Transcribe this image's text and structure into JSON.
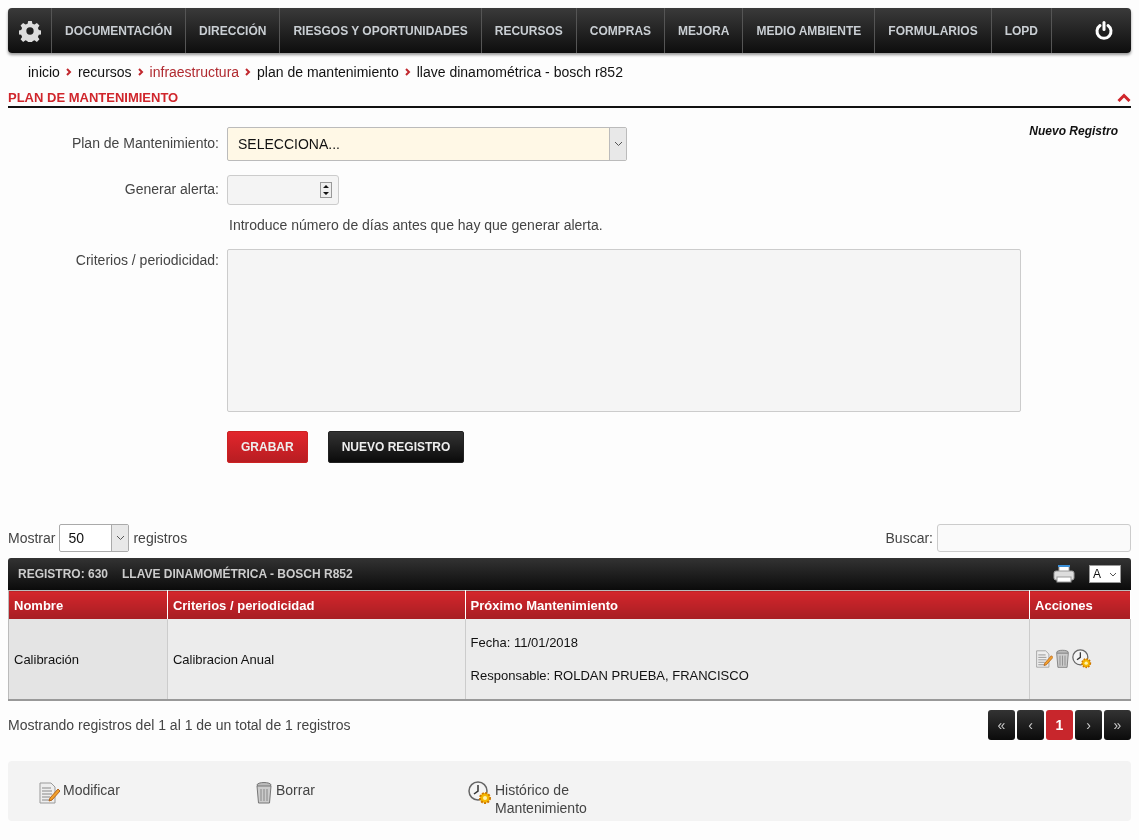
{
  "nav": {
    "items": [
      {
        "label": "DOCUMENTACIÓN"
      },
      {
        "label": "DIRECCIÓN"
      },
      {
        "label": "RIESGOS Y OPORTUNIDADES"
      },
      {
        "label": "RECURSOS"
      },
      {
        "label": "COMPRAS"
      },
      {
        "label": "MEJORA"
      },
      {
        "label": "MEDIO AMBIENTE"
      },
      {
        "label": "FORMULARIOS"
      },
      {
        "label": "LOPD"
      }
    ]
  },
  "breadcrumb": [
    {
      "label": "inicio",
      "kind": "text"
    },
    {
      "label": "recursos",
      "kind": "text"
    },
    {
      "label": "infraestructura",
      "kind": "link"
    },
    {
      "label": "plan de mantenimiento",
      "kind": "text"
    },
    {
      "label": "llave dinamométrica - bosch r852",
      "kind": "text"
    }
  ],
  "section": {
    "title": "PLAN DE MANTENIMIENTO",
    "expanded": true
  },
  "form": {
    "new_record_link": "Nuevo Registro",
    "plan": {
      "label": "Plan de Mantenimiento:",
      "value": "SELECCIONA..."
    },
    "alert": {
      "label": "Generar alerta:",
      "hint": "Introduce número de días antes que hay que generar alerta."
    },
    "criteria": {
      "label": "Criterios / periodicidad:"
    },
    "buttons": [
      {
        "label": "GRABAR",
        "kind": "primary"
      },
      {
        "label": "NUEVO REGISTRO",
        "kind": "dark"
      }
    ]
  },
  "list_controls": {
    "show_label": "Mostrar",
    "page_size": "50",
    "suffix": "registros",
    "search_label": "Buscar:"
  },
  "table": {
    "record": "REGISTRO: 630",
    "title": "LLAVE DINAMOMÉTRICA - BOSCH R852",
    "font_select": "A",
    "columns": [
      "Nombre",
      "Criterios / periodicidad",
      "Próximo Mantenimiento",
      "Acciones"
    ],
    "rows": [
      {
        "name": "Calibración",
        "criteria": "Calibracion Anual",
        "date": "Fecha: 11/01/2018",
        "responsible": "Responsable: ROLDAN PRUEBA, FRANCISCO"
      }
    ]
  },
  "info": "Mostrando registros del 1 al 1 de un total de 1 registros",
  "pagination": [
    {
      "label": "«",
      "selected": false
    },
    {
      "label": "‹",
      "selected": false
    },
    {
      "label": "1",
      "selected": true
    },
    {
      "label": "›",
      "selected": false
    },
    {
      "label": "»",
      "selected": false
    }
  ],
  "legend": [
    {
      "label": "Modificar",
      "kind": "edit"
    },
    {
      "label": "Borrar",
      "kind": "delete"
    },
    {
      "label": "Histórico de Mantenimiento",
      "kind": "history"
    }
  ]
}
